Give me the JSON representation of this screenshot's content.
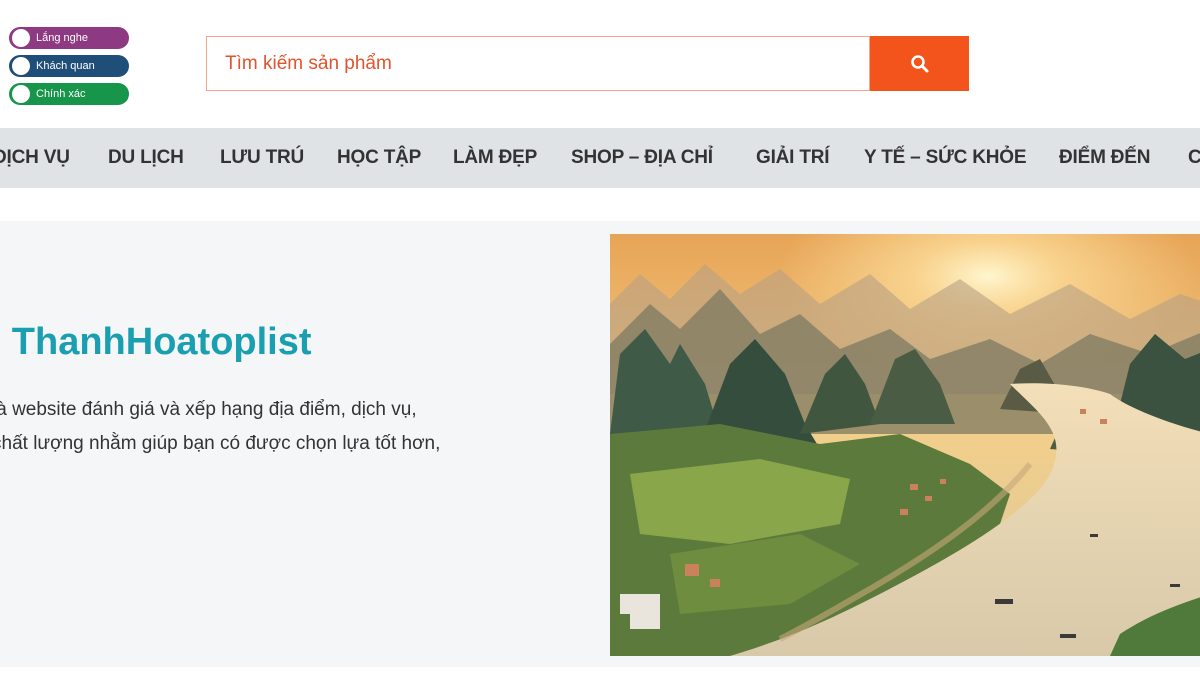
{
  "logo": {
    "badges": [
      {
        "label": "Lắng nghe",
        "color": "#8e3a83"
      },
      {
        "label": "Khách quan",
        "color": "#1f4e79"
      },
      {
        "label": "Chính xác",
        "color": "#17954a"
      }
    ]
  },
  "search": {
    "placeholder": "Tìm kiếm sản phẩm",
    "value": "",
    "button_icon": "search-icon",
    "accent": "#f2541b"
  },
  "nav": {
    "items": [
      "DỊCH VỤ",
      "DU LỊCH",
      "LƯU TRÚ",
      "HỌC TẬP",
      "LÀM ĐẸP",
      "SHOP – ĐỊA CHỈ",
      "GIẢI TRÍ",
      "Y TẾ – SỨC KHỎE",
      "ĐIỂM ĐẾN",
      "C"
    ]
  },
  "hero": {
    "title": "u ThanhHoatoplist",
    "lines": [
      "là website đánh giá và xếp hạng địa điểm, dịch vụ,",
      "chất lượng nhằm giúp bạn có được chọn lựa tốt hơn,"
    ],
    "title_color": "#1a9fb1",
    "image": "landscape-river-karst-mountains-sunset"
  }
}
